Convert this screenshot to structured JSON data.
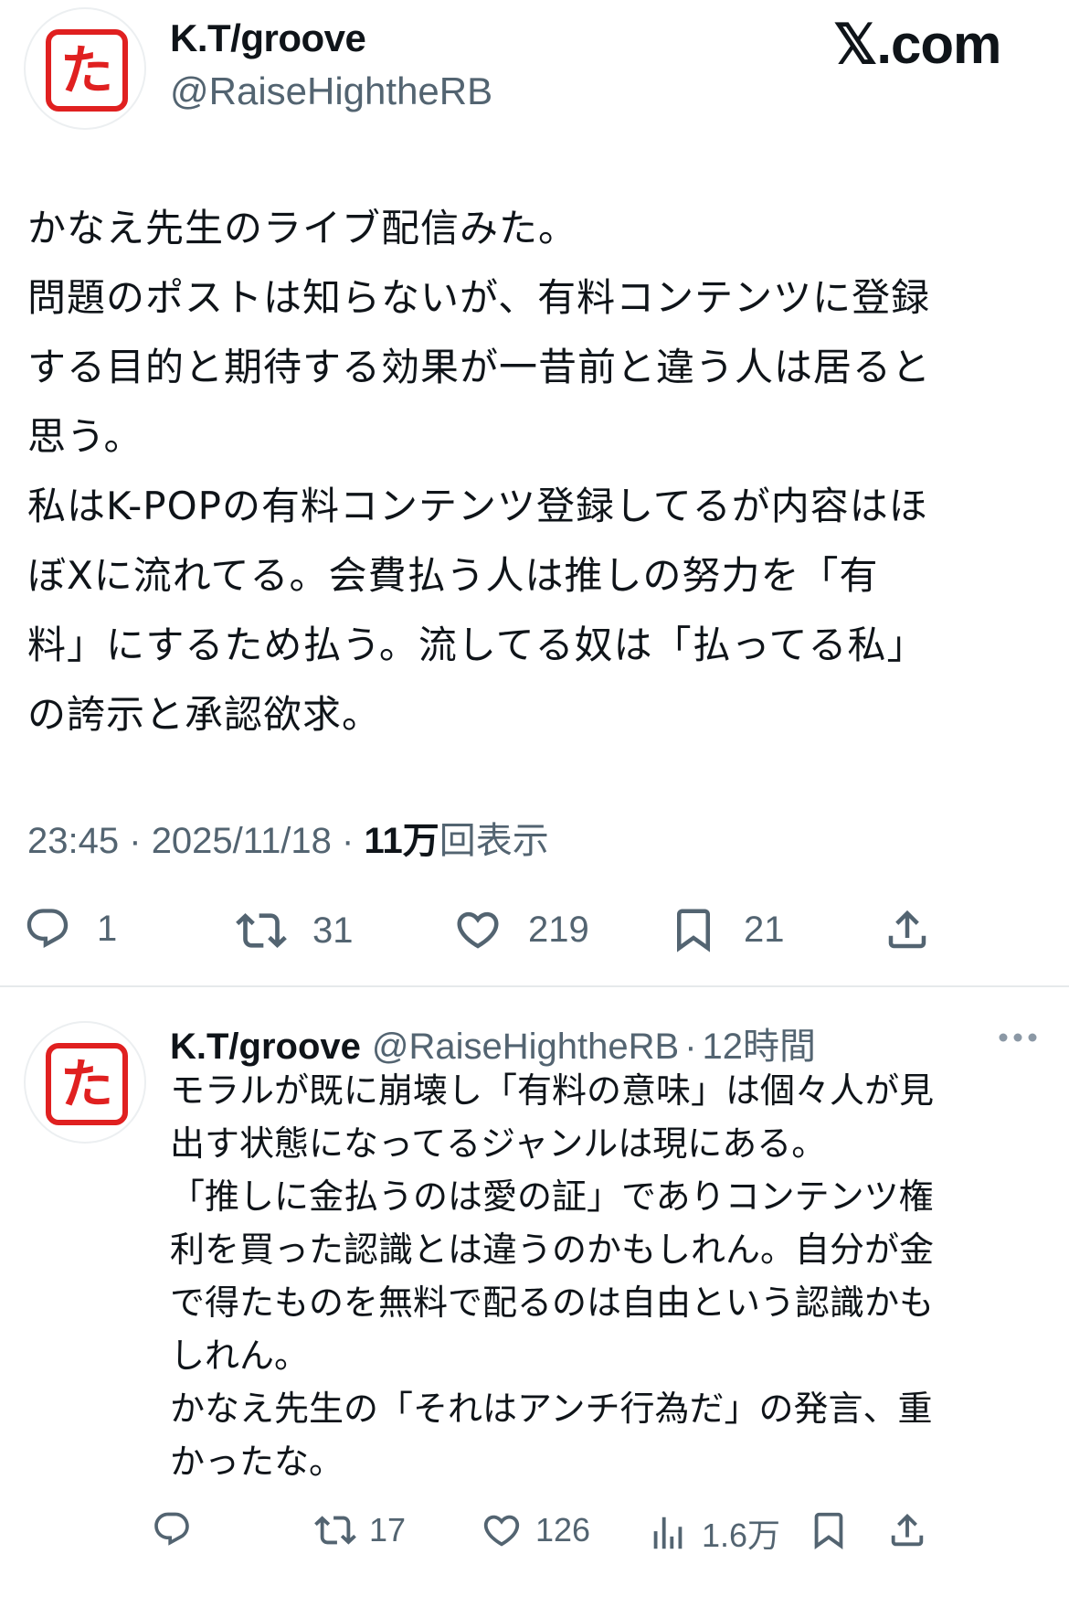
{
  "post": {
    "author": {
      "display_name": "K.T/groove",
      "handle": "@RaiseHightheRB",
      "avatar_char": "た"
    },
    "brand": "𝕏.com",
    "text": "かなえ先生のライブ配信みた。\n問題のポストは知らないが、有料コンテンツに登録\nする目的と期待する効果が一昔前と違う人は居ると\n思う。\n私はK-POPの有料コンテンツ登録してるが内容はほ\nぼXに流れてる。会費払う人は推しの努力を「有\n料」にするため払う。流してる奴は「払ってる私」\nの誇示と承認欲求。",
    "time": "23:45",
    "date": "2025/11/18",
    "separator": "·",
    "views_count": "11万",
    "views_label": "回表示",
    "actions": {
      "replies": "1",
      "reposts": "31",
      "likes": "219",
      "bookmarks": "21"
    }
  },
  "reply": {
    "author": {
      "display_name": "K.T/groove",
      "handle": "@RaiseHightheRB",
      "avatar_char": "た"
    },
    "time_ago": "12時間",
    "separator": "·",
    "text": "モラルが既に崩壊し「有料の意味」は個々人が見\n出す状態になってるジャンルは現にある。\n「推しに金払うのは愛の証」でありコンテンツ権\n利を買った認識とは違うのかもしれん。自分が金\nで得たものを無料で配るのは自由という認識かも\nしれん。\nかなえ先生の「それはアンチ行為だ」の発言、重\nかったな。",
    "actions": {
      "replies": "",
      "reposts": "17",
      "likes": "126",
      "views": "1.6万"
    }
  },
  "colors": {
    "text": "#0f1419",
    "secondary": "#536471",
    "seal_red": "#e02020",
    "divider": "#e6e9eb"
  }
}
